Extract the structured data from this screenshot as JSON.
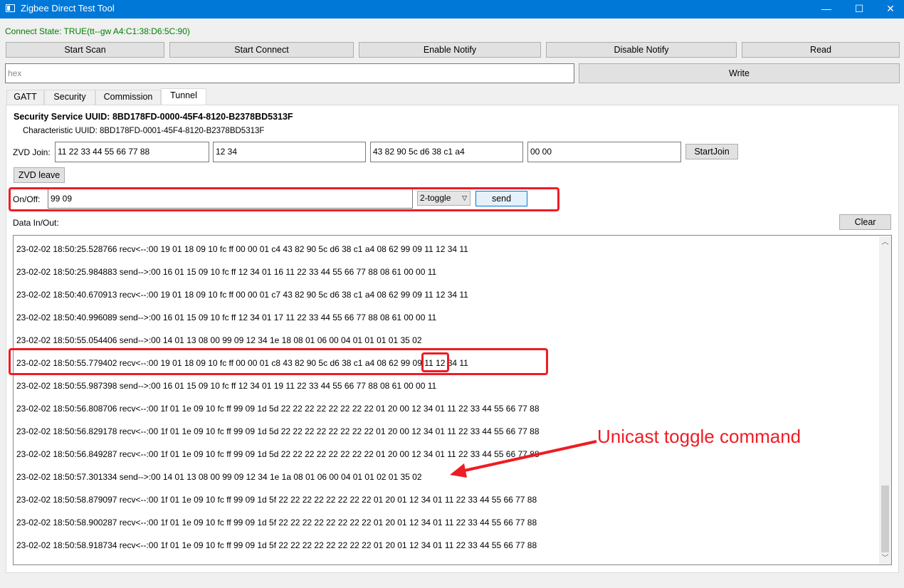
{
  "window": {
    "title": "Zigbee Direct Test Tool",
    "minimize_glyph": "—",
    "maximize_glyph": "☐",
    "close_glyph": "✕"
  },
  "connection": {
    "state_text": "Connect State: TRUE(tt--gw  A4:C1:38:D6:5C:90)",
    "color": "#008000"
  },
  "toolbar": {
    "start_scan": "Start Scan",
    "start_connect": "Start Connect",
    "enable_notify": "Enable Notify",
    "disable_notify": "Disable Notify",
    "read": "Read",
    "write": "Write",
    "hex_placeholder": "hex"
  },
  "tabs": [
    {
      "label": "GATT"
    },
    {
      "label": "Security"
    },
    {
      "label": "Commission"
    },
    {
      "label": "Tunnel",
      "active": true
    }
  ],
  "tunnel": {
    "service_uuid": "Security Service UUID: 8BD178FD-0000-45F4-8120-B2378BD5313F",
    "characteristic_uuid": "Characteristic UUID: 8BD178FD-0001-45F4-8120-B2378BD5313F",
    "zvd_join_label": "ZVD Join:",
    "zvd_join_fields": [
      "11 22 33 44 55 66 77 88",
      "12 34",
      "43 82 90 5c d6 38 c1 a4",
      "00 00"
    ],
    "start_join": "StartJoin",
    "zvd_leave": "ZVD leave",
    "onoff_label": "On/Off:",
    "onoff_value": "99 09",
    "onoff_mode": "2-toggle",
    "send": "send",
    "data_label": "Data In/Out:",
    "clear": "Clear"
  },
  "log": [
    "23-02-02 18:50:25.528766 recv<--:00 19 01 18 09 10 fc ff 00 00 01 c4 43 82 90 5c d6 38 c1 a4 08 62 99 09 11 12 34 11",
    "23-02-02 18:50:25.984883 send-->:00 16 01 15 09 10 fc ff 12 34 01 16 11 22 33 44 55 66 77 88 08 61 00 00 11",
    "23-02-02 18:50:40.670913 recv<--:00 19 01 18 09 10 fc ff 00 00 01 c7 43 82 90 5c d6 38 c1 a4 08 62 99 09 11 12 34 11",
    "23-02-02 18:50:40.996089 send-->:00 16 01 15 09 10 fc ff 12 34 01 17 11 22 33 44 55 66 77 88 08 61 00 00 11",
    "23-02-02 18:50:55.054406 send-->:00 14 01 13 08 00 99 09 12 34 1e 18 08 01 06 00 04 01 01 01 01 35 02",
    "23-02-02 18:50:55.779402 recv<--:00 19 01 18 09 10 fc ff 00 00 01 c8 43 82 90 5c d6 38 c1 a4 08 62 99 09 11 12 34 11",
    "23-02-02 18:50:55.987398 send-->:00 16 01 15 09 10 fc ff 12 34 01 19 11 22 33 44 55 66 77 88 08 61 00 00 11",
    "23-02-02 18:50:56.808706 recv<--:00 1f 01 1e 09 10 fc ff 99 09 1d 5d 22 22 22 22 22 22 22 22 01 20 00 12 34 01 11 22 33 44 55 66 77 88",
    "23-02-02 18:50:56.829178 recv<--:00 1f 01 1e 09 10 fc ff 99 09 1d 5d 22 22 22 22 22 22 22 22 01 20 00 12 34 01 11 22 33 44 55 66 77 88",
    "23-02-02 18:50:56.849287 recv<--:00 1f 01 1e 09 10 fc ff 99 09 1d 5d 22 22 22 22 22 22 22 22 01 20 00 12 34 01 11 22 33 44 55 66 77 88",
    "23-02-02 18:50:57.301334 send-->:00 14 01 13 08 00 99 09 12 34 1e 1a 08 01 06 00 04 01 01 02 01 35 02",
    "23-02-02 18:50:58.879097 recv<--:00 1f 01 1e 09 10 fc ff 99 09 1d 5f 22 22 22 22 22 22 22 22 01 20 01 12 34 01 11 22 33 44 55 66 77 88",
    "23-02-02 18:50:58.900287 recv<--:00 1f 01 1e 09 10 fc ff 99 09 1d 5f 22 22 22 22 22 22 22 22 01 20 01 12 34 01 11 22 33 44 55 66 77 88",
    "23-02-02 18:50:58.918734 recv<--:00 1f 01 1e 09 10 fc ff 99 09 1d 5f 22 22 22 22 22 22 22 22 01 20 01 12 34 01 11 22 33 44 55 66 77 88"
  ],
  "annotation": {
    "text": "Unicast toggle command",
    "color": "#ee1c24"
  },
  "colors": {
    "titlebar": "#0078d7",
    "annotation_red": "#ee1c24"
  }
}
